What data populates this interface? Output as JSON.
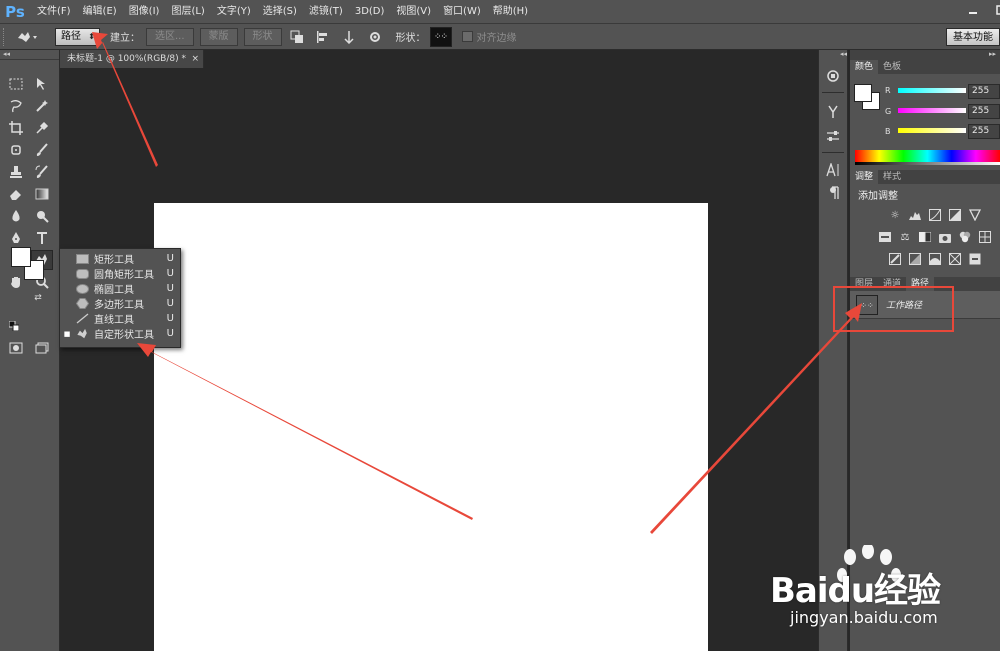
{
  "app": {
    "logo": "Ps",
    "menu": [
      "文件(F)",
      "编辑(E)",
      "图像(I)",
      "图层(L)",
      "文字(Y)",
      "选择(S)",
      "滤镜(T)",
      "3D(D)",
      "视图(V)",
      "窗口(W)",
      "帮助(H)"
    ]
  },
  "options_bar": {
    "mode_select": "路径",
    "build_label": "建立：",
    "btn_selection": "选区...",
    "btn_mask": "蒙版",
    "btn_shape": "形状",
    "shape_label": "形状：",
    "align_edges": "对齐边缘",
    "workspace": "基本功能"
  },
  "document": {
    "tab_title": "未标题-1 @ 100%(RGB/8) *",
    "tab_close": "×"
  },
  "flyout": {
    "items": [
      {
        "label": "矩形工具",
        "key": "U",
        "icon": "rectangle-icon",
        "selected": false
      },
      {
        "label": "圆角矩形工具",
        "key": "U",
        "icon": "rounded-rectangle-icon",
        "selected": false
      },
      {
        "label": "椭圆工具",
        "key": "U",
        "icon": "ellipse-icon",
        "selected": false
      },
      {
        "label": "多边形工具",
        "key": "U",
        "icon": "polygon-icon",
        "selected": false
      },
      {
        "label": "直线工具",
        "key": "U",
        "icon": "line-icon",
        "selected": false
      },
      {
        "label": "自定形状工具",
        "key": "U",
        "icon": "custom-shape-icon",
        "selected": true
      }
    ]
  },
  "color_panel": {
    "tabs": [
      "颜色",
      "色板"
    ],
    "channels": [
      {
        "label": "R",
        "value": "255"
      },
      {
        "label": "G",
        "value": "255"
      },
      {
        "label": "B",
        "value": "255"
      }
    ]
  },
  "adjust_panel": {
    "tabs": [
      "调整",
      "样式"
    ],
    "title": "添加调整"
  },
  "layers_panel": {
    "tabs": [
      "图层",
      "通道",
      "路径"
    ],
    "path_name": "工作路径"
  },
  "watermark": {
    "brand": "Baidu经验",
    "url": "jingyan.baidu.com"
  },
  "colors": {
    "annotation_red": "#e8483a",
    "ui_gray": "#535353",
    "canvas_bg": "#282828"
  }
}
